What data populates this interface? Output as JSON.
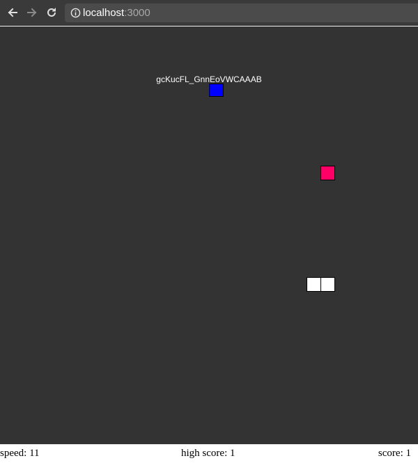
{
  "browser": {
    "url_host": "localhost",
    "url_port": ":3000",
    "icons": [
      "back-arrow-icon",
      "forward-arrow-icon",
      "reload-icon",
      "info-icon"
    ]
  },
  "game": {
    "player_name": "gcKucFL_GnnEoVWCAAAB",
    "colors": {
      "background": "#333333",
      "enemy": "#0000ff",
      "food": "#ff0066",
      "player_body": "#ffffff"
    }
  },
  "status": {
    "speed": "speed: 11",
    "high_score": "high score: 1",
    "score": "score: 1"
  }
}
